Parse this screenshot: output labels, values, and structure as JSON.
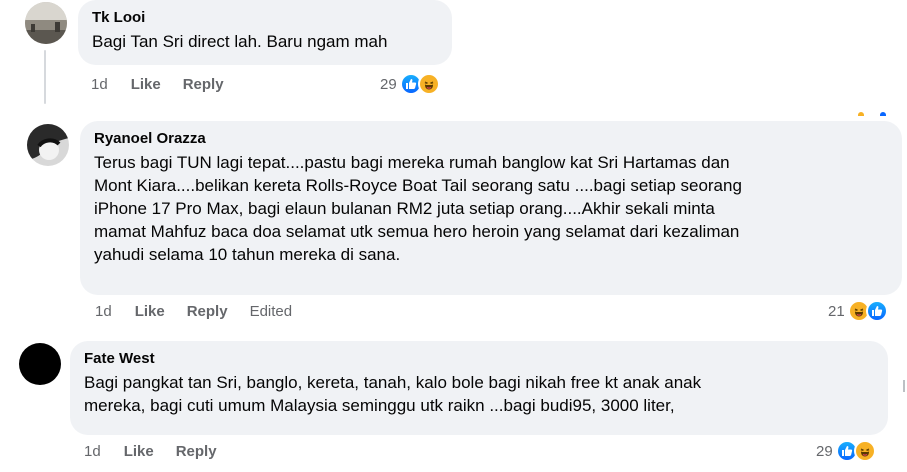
{
  "comments": [
    {
      "author": "Tk Looi",
      "text": "Bagi Tan Sri direct lah. Baru ngam mah",
      "timestamp": "1d",
      "like_label": "Like",
      "reply_label": "Reply",
      "reaction_count": "29",
      "reactions": [
        "like-icon",
        "haha-icon"
      ]
    },
    {
      "author": "Ryanoel Orazza",
      "text_lines": [
        "Terus bagi TUN lagi tepat....pastu bagi mereka rumah banglow kat Sri Hartamas dan",
        "Mont Kiara....belikan kereta Rolls-Royce Boat Tail seorang satu ....bagi setiap seorang",
        "iPhone 17 Pro Max, bagi elaun bulanan RM2 juta setiap orang....Akhir sekali minta",
        "mamat Mahfuz baca doa selamat utk semua hero heroin yang selamat dari kezaliman",
        "yahudi selama 10 tahun mereka di sana."
      ],
      "timestamp": "1d",
      "like_label": "Like",
      "reply_label": "Reply",
      "edited_label": "Edited",
      "reaction_count": "21",
      "reactions": [
        "haha-icon",
        "like-icon"
      ]
    },
    {
      "author": "Fate West",
      "text_lines": [
        "Bagi pangkat tan Sri, banglo, kereta, tanah, kalo bole bagi nikah free kt anak anak",
        "mereka, bagi cuti umum Malaysia seminggu utk raikn ...bagi budi95, 3000 liter,"
      ],
      "timestamp": "1d",
      "like_label": "Like",
      "reply_label": "Reply",
      "reaction_count": "29",
      "reactions": [
        "like-icon",
        "haha-icon"
      ]
    }
  ],
  "colors": {
    "bubble_bg": "#f0f2f5",
    "meta_text": "#65676b",
    "like_blue": "#0866ff",
    "haha_yellow": "#f7b125"
  }
}
